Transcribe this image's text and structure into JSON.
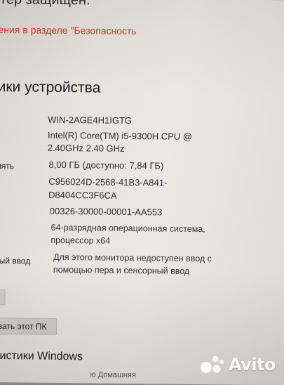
{
  "top_title": "тер защищен.",
  "security_link": "ения в разделе \"Безопасность",
  "section_heading": "ики устройства",
  "specs": {
    "device_name": "WIN-2AGE4H1IGTG",
    "processor_line1": "Intel(R) Core(TM) i5-9300H CPU @",
    "processor_line2": "2.40GHz   2.40 GHz",
    "ram_label": "мять",
    "ram_value": "8,00 ГБ (доступно: 7,84 ГБ)",
    "device_id_line1": "C956024D-2568-41B3-A841-",
    "device_id_line2": "D8404CC3F6CA",
    "product_id": "00326-30000-00001-AA553",
    "system_type_line1": "64-разрядная операционная система,",
    "system_type_line2": "процессор x64",
    "pen_label": "ный ввод",
    "pen_value_line1": "Для этого монитора недоступен ввод с",
    "pen_value_line2": "помощью пера и сенсорный ввод"
  },
  "buttons": {
    "copy_fragment": "»",
    "rename_label": "овать этот ПК"
  },
  "bottom_heading": "ристики Windows",
  "bottom_faint": "ю Домашняя",
  "watermark": {
    "text": "Avito",
    "icon": "avito-logo-icon"
  }
}
